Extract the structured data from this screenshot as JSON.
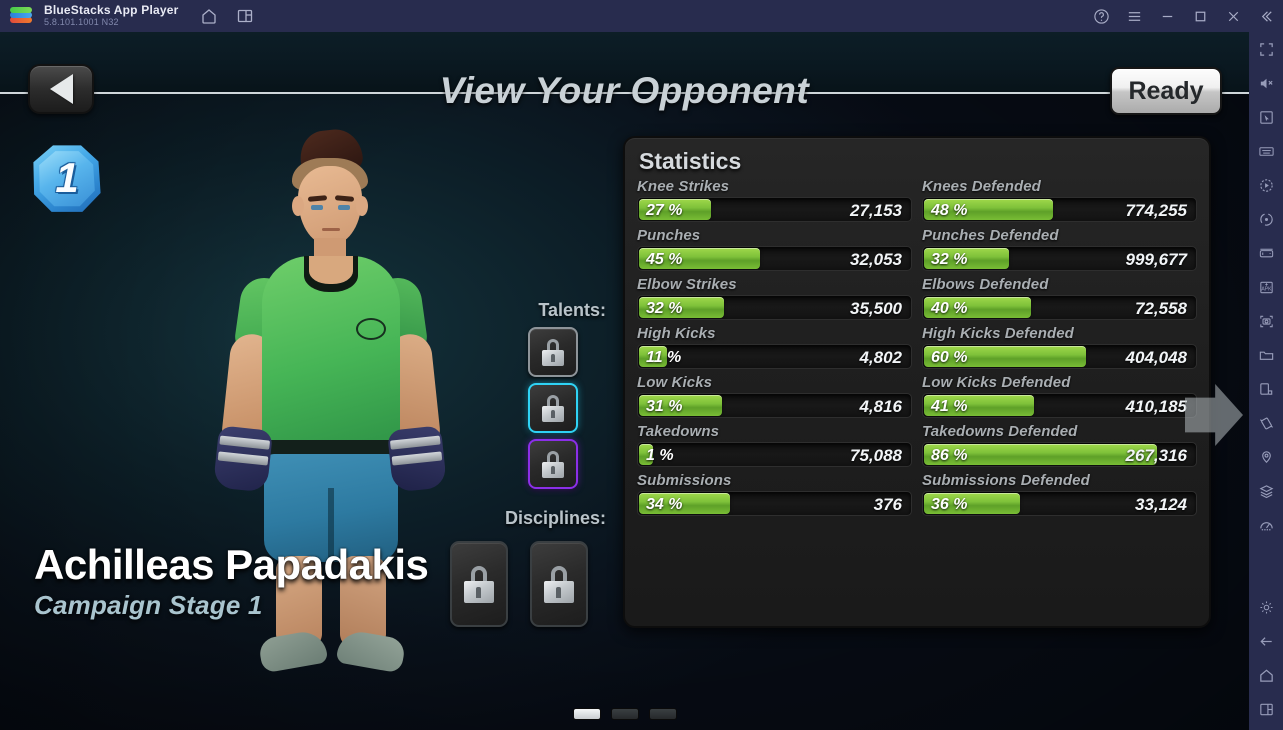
{
  "titlebar": {
    "app_name": "BlueStacks App Player",
    "version": "5.8.101.1001  N32",
    "icons_left": [
      "home-icon",
      "multi-instance-icon"
    ],
    "icons_right": [
      "help-icon",
      "menu-icon",
      "minimize-icon",
      "maximize-icon",
      "close-icon",
      "collapse-icon"
    ],
    "bg_color": "#282c4e"
  },
  "header": {
    "back_label": "back-arrow",
    "title": "View Your Opponent",
    "ready_label": "Ready"
  },
  "fighter": {
    "rank": "1",
    "name": "Achilleas Papadakis",
    "stage": "Campaign Stage 1",
    "shirt_color": "#46b556",
    "shorts_color": "#2d7aa1"
  },
  "talents": {
    "label": "Talents:",
    "slots": [
      {
        "state": "locked",
        "border": "#8e9499"
      },
      {
        "state": "locked",
        "border": "#2fd3f5"
      },
      {
        "state": "locked",
        "border": "#8b2fe8"
      }
    ]
  },
  "disciplines": {
    "label": "Disciplines:",
    "slots": [
      {
        "state": "locked"
      },
      {
        "state": "locked"
      }
    ]
  },
  "statistics": {
    "title": "Statistics",
    "left": [
      {
        "label": "Knee Strikes",
        "percent": 27,
        "percent_text": "27 %",
        "value": "27,153"
      },
      {
        "label": "Punches",
        "percent": 45,
        "percent_text": "45 %",
        "value": "32,053"
      },
      {
        "label": "Elbow Strikes",
        "percent": 32,
        "percent_text": "32 %",
        "value": "35,500"
      },
      {
        "label": "High Kicks",
        "percent": 11,
        "percent_text": "11 %",
        "value": "4,802"
      },
      {
        "label": "Low Kicks",
        "percent": 31,
        "percent_text": "31 %",
        "value": "4,816"
      },
      {
        "label": "Takedowns",
        "percent": 1,
        "percent_text": "1 %",
        "value": "75,088"
      },
      {
        "label": "Submissions",
        "percent": 34,
        "percent_text": "34 %",
        "value": "376"
      }
    ],
    "right": [
      {
        "label": "Knees Defended",
        "percent": 48,
        "percent_text": "48 %",
        "value": "774,255"
      },
      {
        "label": "Punches Defended",
        "percent": 32,
        "percent_text": "32 %",
        "value": "999,677"
      },
      {
        "label": "Elbows Defended",
        "percent": 40,
        "percent_text": "40 %",
        "value": "72,558"
      },
      {
        "label": "High Kicks Defended",
        "percent": 60,
        "percent_text": "60 %",
        "value": "404,048"
      },
      {
        "label": "Low Kicks Defended",
        "percent": 41,
        "percent_text": "41 %",
        "value": "410,185"
      },
      {
        "label": "Takedowns Defended",
        "percent": 86,
        "percent_text": "86 %",
        "value": "267,316"
      },
      {
        "label": "Submissions Defended",
        "percent": 36,
        "percent_text": "36 %",
        "value": "33,124"
      }
    ],
    "bar_fill_color": "#7ec13a",
    "panel_bg": "#1f1f1f"
  },
  "pagination": {
    "pages": 3,
    "active": 1
  },
  "next_arrow": "next-page-arrow",
  "sidebar": {
    "top_icons": [
      "fullscreen-icon",
      "mute-icon",
      "cursor-icon",
      "keyboard-icon",
      "macro-play-icon",
      "rotate-icon",
      "gamepad-icon",
      "apk-install-icon",
      "screenshot-icon",
      "folder-icon",
      "multi-instance-icon",
      "shake-icon",
      "location-icon",
      "layers-icon",
      "speedmeter-icon"
    ],
    "bottom_icons": [
      "settings-icon",
      "back-icon",
      "home-icon",
      "recents-icon"
    ]
  }
}
